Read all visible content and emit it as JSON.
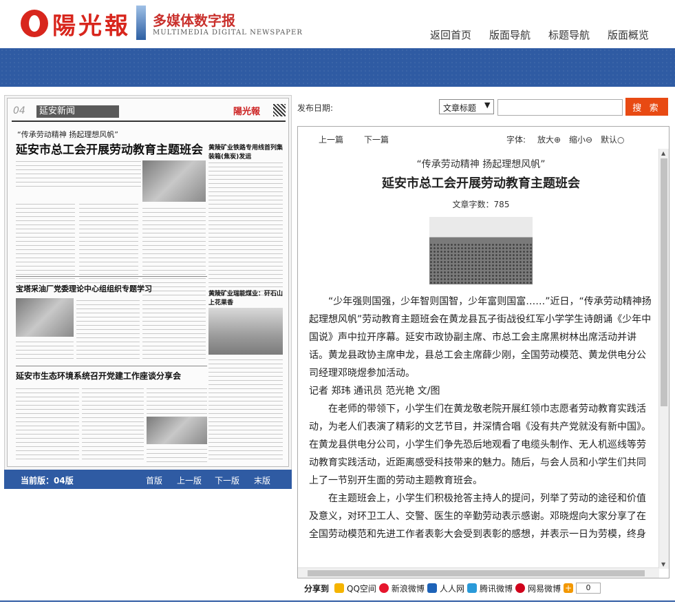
{
  "header": {
    "logo_text": "陽光報",
    "brand_title": "多媒体数字报",
    "brand_subtitle": "MULTIMEDIA DIGITAL NEWSPAPER",
    "nav": [
      "返回首页",
      "版面导航",
      "标题导航",
      "版面概览"
    ]
  },
  "paper": {
    "page_no": "04",
    "section": "延安新闻",
    "logo_mini": "陽光報",
    "headline_sub": "“传承劳动精神 扬起理想风帆”",
    "headline": "延安市总工会开展劳动教育主题班会",
    "side_title_1": "黄陵矿业铁路专用线首列集装箱(焦炭)发运",
    "side_title_2": "黄陵矿业瑞能煤业：矸石山上花果香",
    "story_2": "宝塔采油厂党委理论中心组组织专题学习",
    "story_3": "延安市生态环境系统召开党建工作座谈分享会"
  },
  "page_bar": {
    "current": "当前版：04版",
    "links": [
      "首版",
      "上一版",
      "下一版",
      "末版"
    ]
  },
  "search": {
    "label": "发布日期:",
    "select_value": "文章标题",
    "button": "搜 索"
  },
  "toolbar": {
    "prev": "上一篇",
    "next": "下一篇",
    "font_label": "字体:",
    "enlarge": "放大⊕",
    "shrink": "缩小⊖",
    "default": "默认○"
  },
  "article": {
    "subtitle": "“传承劳动精神 扬起理想风帆”",
    "title": "延安市总工会开展劳动教育主题班会",
    "word_count": "文章字数：785",
    "p1": "“少年强则国强，少年智则国智，少年富则国富……”近日，“传承劳动精神扬起理想风帆”劳动教育主题班会在黄龙县瓦子街战役红军小学学生诗朗诵《少年中国说》声中拉开序幕。延安市政协副主席、市总工会主席黑树林出席活动并讲话。黄龙县政协主席申龙，县总工会主席薛少刚，全国劳动模范、黄龙供电分公司经理邓晓煜参加活动。",
    "byline": "记者 郑玮 通讯员 范光艳 文/图",
    "p2": "在老师的带领下，小学生们在黄龙敬老院开展红领巾志愿者劳动教育实践活动，为老人们表演了精彩的文艺节目，并深情合唱《没有共产党就没有新中国》。在黄龙县供电分公司，小学生们争先恐后地观看了电缆头制作、无人机巡线等劳动教育实践活动，近距离感受科技带来的魅力。随后，与会人员和小学生们共同上了一节别开生面的劳动主题教育班会。",
    "p3": "在主题班会上，小学生们积极抢答主持人的提问，列举了劳动的途径和价值及意义，对环卫工人、交警、医生的辛勤劳动表示感谢。邓晓煜向大家分享了在全国劳动模范和先进工作者表彰大会受到表彰的感想，并表示一日为劳模，终身"
  },
  "share": {
    "label": "分享到",
    "items": [
      "QQ空间",
      "新浪微博",
      "人人网",
      "腾讯微博",
      "网易微博"
    ],
    "count": "0"
  },
  "colors": {
    "brand_red": "#d8261d",
    "banner_blue": "#2f5ba3",
    "search_orange": "#e84a13"
  }
}
